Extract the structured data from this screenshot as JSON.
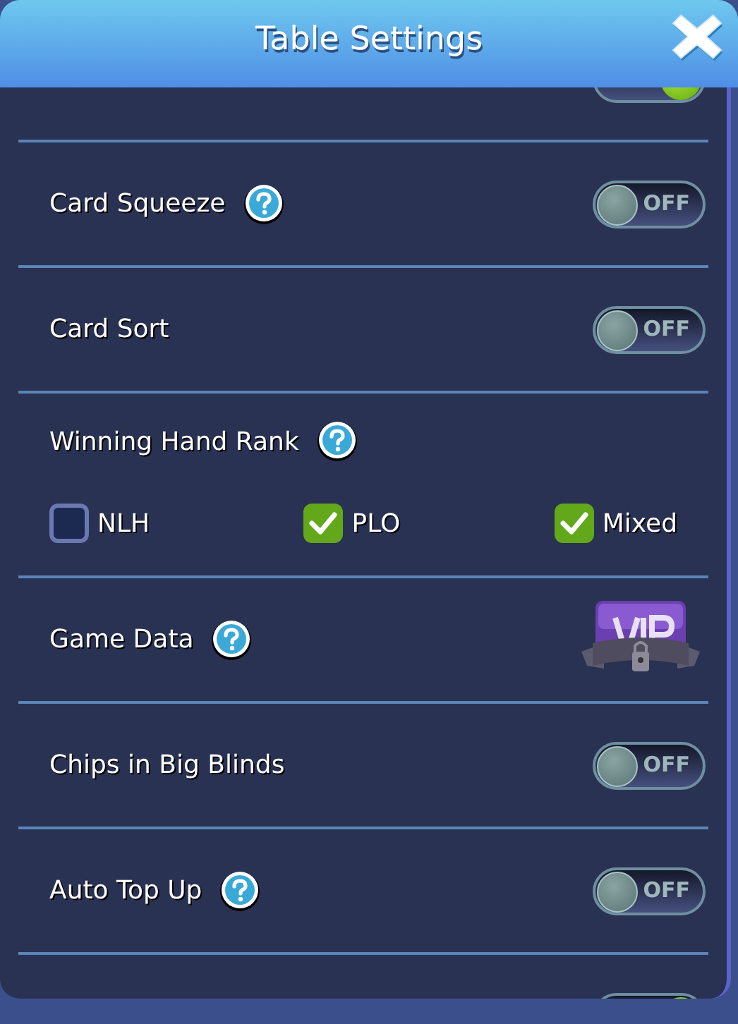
{
  "window": {
    "title": "Table Settings"
  },
  "settings": [
    {
      "kind": "toggle",
      "on": true
    },
    {
      "kind": "toggle",
      "label": "Card Squeeze",
      "help": true,
      "on": false,
      "state_text": "OFF"
    },
    {
      "kind": "toggle",
      "label": "Card Sort",
      "help": false,
      "on": false,
      "state_text": "OFF"
    },
    {
      "kind": "checkgroup",
      "label": "Winning Hand Rank",
      "help": true,
      "options": [
        {
          "label": "NLH",
          "checked": false
        },
        {
          "label": "PLO",
          "checked": true
        },
        {
          "label": "Mixed",
          "checked": true
        }
      ]
    },
    {
      "kind": "vip",
      "label": "Game Data",
      "help": true
    },
    {
      "kind": "toggle",
      "label": "Chips in Big Blinds",
      "help": false,
      "on": false,
      "state_text": "OFF"
    },
    {
      "kind": "toggle",
      "label": "Auto Top Up",
      "help": true,
      "on": false,
      "state_text": "OFF"
    },
    {
      "kind": "toggle",
      "on": true
    }
  ]
}
